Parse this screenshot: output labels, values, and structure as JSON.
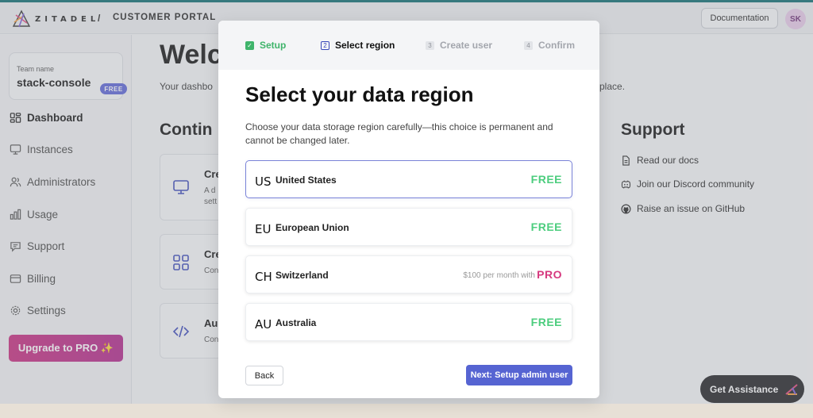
{
  "header": {
    "brand": "ZITADEL",
    "separator": "/",
    "portal": "CUSTOMER PORTAL",
    "documentation": "Documentation",
    "avatar_initials": "SK"
  },
  "sidebar": {
    "team_label": "Team name",
    "team_name": "stack-console",
    "plan_badge": "FREE",
    "items": [
      {
        "label": "Dashboard",
        "icon": "dashboard-icon"
      },
      {
        "label": "Instances",
        "icon": "monitor-icon"
      },
      {
        "label": "Administrators",
        "icon": "users-icon"
      },
      {
        "label": "Usage",
        "icon": "bar-chart-icon"
      },
      {
        "label": "Support",
        "icon": "chat-icon"
      },
      {
        "label": "Billing",
        "icon": "card-icon"
      },
      {
        "label": "Settings",
        "icon": "gear-icon"
      }
    ],
    "upgrade": "Upgrade to PRO ✨"
  },
  "background": {
    "title": "Welc",
    "sub_left": "Your dashbo",
    "sub_right": "place.",
    "continue": "Contin",
    "cards": [
      {
        "t1": "Cre",
        "t2": "A d",
        "t3": "sett"
      },
      {
        "t1": "Cre",
        "t2": "Con",
        "t3": ""
      },
      {
        "t1": "Au",
        "t2": "Con",
        "t3": ""
      }
    ],
    "support_title": "Support",
    "support_items": [
      "Read our docs",
      "Join our Discord community",
      "Raise an issue on GitHub"
    ],
    "assist": "Get Assistance"
  },
  "modal": {
    "steps": [
      {
        "num": "✓",
        "label": "Setup"
      },
      {
        "num": "2",
        "label": "Select region"
      },
      {
        "num": "3",
        "label": "Create user"
      },
      {
        "num": "4",
        "label": "Confirm"
      }
    ],
    "title": "Select your data region",
    "description": "Choose your data storage region carefully—this choice is permanent and cannot be changed later.",
    "regions": [
      {
        "code": "US",
        "name": "United States",
        "price": "",
        "tier": "FREE"
      },
      {
        "code": "EU",
        "name": "European Union",
        "price": "",
        "tier": "FREE"
      },
      {
        "code": "CH",
        "name": "Switzerland",
        "price": "$100 per month with",
        "tier": "PRO"
      },
      {
        "code": "AU",
        "name": "Australia",
        "price": "",
        "tier": "FREE"
      }
    ],
    "back": "Back",
    "next": "Next: Setup admin user"
  },
  "colors": {
    "accent": "#5664d2",
    "success": "#3fb46b",
    "free": "#4ccd7e",
    "pro": "#d6397f"
  }
}
